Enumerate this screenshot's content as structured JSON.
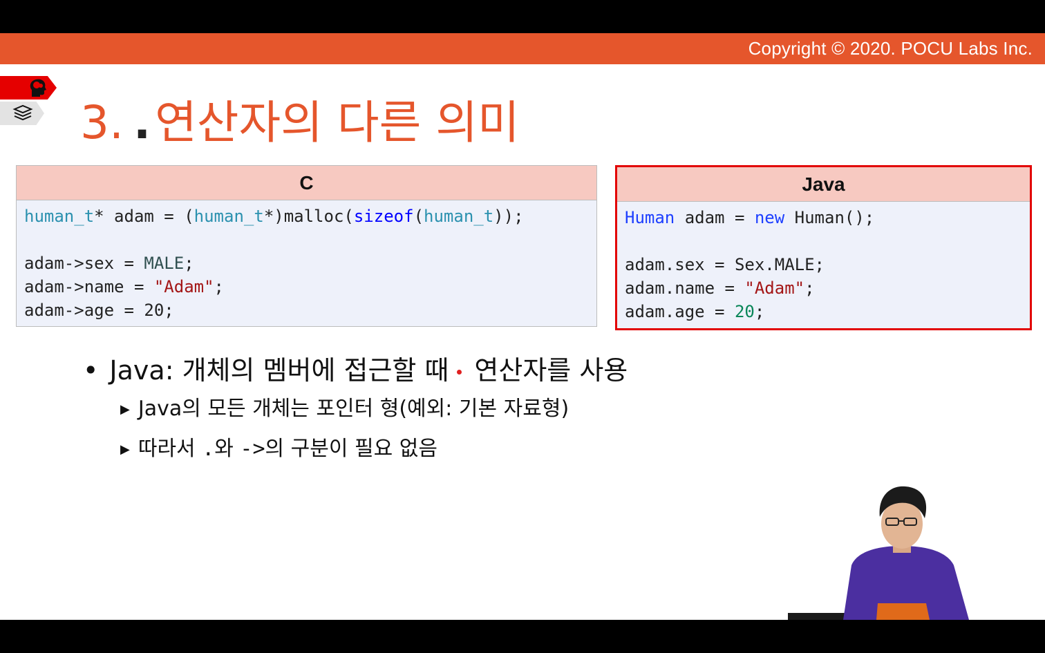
{
  "header": {
    "copyright": "Copyright © 2020. POCU Labs Inc."
  },
  "title": {
    "number": "3.",
    "dot": ".",
    "text": "연산자의 다른 의미"
  },
  "panels": {
    "c": {
      "heading": "C",
      "lines": [
        [
          {
            "t": "type",
            "v": "human_t"
          },
          {
            "t": "plain",
            "v": "* adam = ("
          },
          {
            "t": "type",
            "v": "human_t"
          },
          {
            "t": "plain",
            "v": "*)malloc("
          },
          {
            "t": "kw",
            "v": "sizeof"
          },
          {
            "t": "plain",
            "v": "("
          },
          {
            "t": "type",
            "v": "human_t"
          },
          {
            "t": "plain",
            "v": "));"
          }
        ],
        [],
        [
          {
            "t": "plain",
            "v": "adam->sex = "
          },
          {
            "t": "enum",
            "v": "MALE"
          },
          {
            "t": "plain",
            "v": ";"
          }
        ],
        [
          {
            "t": "plain",
            "v": "adam->name = "
          },
          {
            "t": "str",
            "v": "\"Adam\""
          },
          {
            "t": "plain",
            "v": ";"
          }
        ],
        [
          {
            "t": "plain",
            "v": "adam->age = 20;"
          }
        ]
      ]
    },
    "java": {
      "heading": "Java",
      "lines": [
        [
          {
            "t": "kw2",
            "v": "Human"
          },
          {
            "t": "plain",
            "v": " adam = "
          },
          {
            "t": "kw2",
            "v": "new"
          },
          {
            "t": "plain",
            "v": " Human();"
          }
        ],
        [],
        [
          {
            "t": "plain",
            "v": "adam.sex = Sex.MALE;"
          }
        ],
        [
          {
            "t": "plain",
            "v": "adam.name = "
          },
          {
            "t": "str",
            "v": "\"Adam\""
          },
          {
            "t": "plain",
            "v": ";"
          }
        ],
        [
          {
            "t": "plain",
            "v": "adam.age = "
          },
          {
            "t": "num",
            "v": "20"
          },
          {
            "t": "plain",
            "v": ";"
          }
        ]
      ]
    }
  },
  "bullets": {
    "main_prefix": "Java: 개체의 멤버에 접근할 때",
    "main_suffix": "연산자를 사용",
    "sub1": "Java의 모든 개체는 포인터 형(예외: 기본 자료형)",
    "sub2_prefix": "따라서",
    "sub2_code1": ".와",
    "sub2_code2": "->",
    "sub2_suffix": "의 구분이 필요 없음"
  },
  "icons": {
    "brain": "brain-head-icon",
    "books": "book-stack-icon"
  }
}
